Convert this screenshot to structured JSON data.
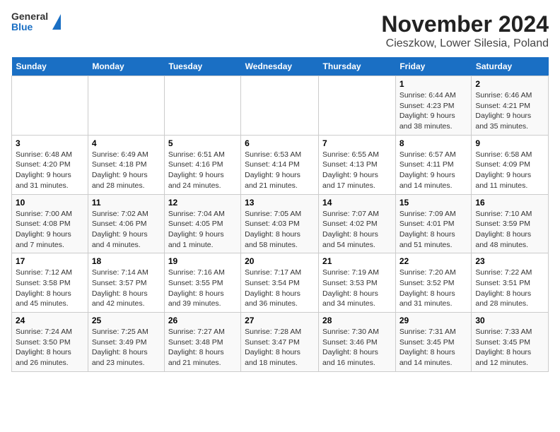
{
  "header": {
    "logo_general": "General",
    "logo_blue": "Blue",
    "title": "November 2024",
    "subtitle": "Cieszkow, Lower Silesia, Poland"
  },
  "weekdays": [
    "Sunday",
    "Monday",
    "Tuesday",
    "Wednesday",
    "Thursday",
    "Friday",
    "Saturday"
  ],
  "weeks": [
    [
      {
        "day": "",
        "info": ""
      },
      {
        "day": "",
        "info": ""
      },
      {
        "day": "",
        "info": ""
      },
      {
        "day": "",
        "info": ""
      },
      {
        "day": "",
        "info": ""
      },
      {
        "day": "1",
        "info": "Sunrise: 6:44 AM\nSunset: 4:23 PM\nDaylight: 9 hours and 38 minutes."
      },
      {
        "day": "2",
        "info": "Sunrise: 6:46 AM\nSunset: 4:21 PM\nDaylight: 9 hours and 35 minutes."
      }
    ],
    [
      {
        "day": "3",
        "info": "Sunrise: 6:48 AM\nSunset: 4:20 PM\nDaylight: 9 hours and 31 minutes."
      },
      {
        "day": "4",
        "info": "Sunrise: 6:49 AM\nSunset: 4:18 PM\nDaylight: 9 hours and 28 minutes."
      },
      {
        "day": "5",
        "info": "Sunrise: 6:51 AM\nSunset: 4:16 PM\nDaylight: 9 hours and 24 minutes."
      },
      {
        "day": "6",
        "info": "Sunrise: 6:53 AM\nSunset: 4:14 PM\nDaylight: 9 hours and 21 minutes."
      },
      {
        "day": "7",
        "info": "Sunrise: 6:55 AM\nSunset: 4:13 PM\nDaylight: 9 hours and 17 minutes."
      },
      {
        "day": "8",
        "info": "Sunrise: 6:57 AM\nSunset: 4:11 PM\nDaylight: 9 hours and 14 minutes."
      },
      {
        "day": "9",
        "info": "Sunrise: 6:58 AM\nSunset: 4:09 PM\nDaylight: 9 hours and 11 minutes."
      }
    ],
    [
      {
        "day": "10",
        "info": "Sunrise: 7:00 AM\nSunset: 4:08 PM\nDaylight: 9 hours and 7 minutes."
      },
      {
        "day": "11",
        "info": "Sunrise: 7:02 AM\nSunset: 4:06 PM\nDaylight: 9 hours and 4 minutes."
      },
      {
        "day": "12",
        "info": "Sunrise: 7:04 AM\nSunset: 4:05 PM\nDaylight: 9 hours and 1 minute."
      },
      {
        "day": "13",
        "info": "Sunrise: 7:05 AM\nSunset: 4:03 PM\nDaylight: 8 hours and 58 minutes."
      },
      {
        "day": "14",
        "info": "Sunrise: 7:07 AM\nSunset: 4:02 PM\nDaylight: 8 hours and 54 minutes."
      },
      {
        "day": "15",
        "info": "Sunrise: 7:09 AM\nSunset: 4:01 PM\nDaylight: 8 hours and 51 minutes."
      },
      {
        "day": "16",
        "info": "Sunrise: 7:10 AM\nSunset: 3:59 PM\nDaylight: 8 hours and 48 minutes."
      }
    ],
    [
      {
        "day": "17",
        "info": "Sunrise: 7:12 AM\nSunset: 3:58 PM\nDaylight: 8 hours and 45 minutes."
      },
      {
        "day": "18",
        "info": "Sunrise: 7:14 AM\nSunset: 3:57 PM\nDaylight: 8 hours and 42 minutes."
      },
      {
        "day": "19",
        "info": "Sunrise: 7:16 AM\nSunset: 3:55 PM\nDaylight: 8 hours and 39 minutes."
      },
      {
        "day": "20",
        "info": "Sunrise: 7:17 AM\nSunset: 3:54 PM\nDaylight: 8 hours and 36 minutes."
      },
      {
        "day": "21",
        "info": "Sunrise: 7:19 AM\nSunset: 3:53 PM\nDaylight: 8 hours and 34 minutes."
      },
      {
        "day": "22",
        "info": "Sunrise: 7:20 AM\nSunset: 3:52 PM\nDaylight: 8 hours and 31 minutes."
      },
      {
        "day": "23",
        "info": "Sunrise: 7:22 AM\nSunset: 3:51 PM\nDaylight: 8 hours and 28 minutes."
      }
    ],
    [
      {
        "day": "24",
        "info": "Sunrise: 7:24 AM\nSunset: 3:50 PM\nDaylight: 8 hours and 26 minutes."
      },
      {
        "day": "25",
        "info": "Sunrise: 7:25 AM\nSunset: 3:49 PM\nDaylight: 8 hours and 23 minutes."
      },
      {
        "day": "26",
        "info": "Sunrise: 7:27 AM\nSunset: 3:48 PM\nDaylight: 8 hours and 21 minutes."
      },
      {
        "day": "27",
        "info": "Sunrise: 7:28 AM\nSunset: 3:47 PM\nDaylight: 8 hours and 18 minutes."
      },
      {
        "day": "28",
        "info": "Sunrise: 7:30 AM\nSunset: 3:46 PM\nDaylight: 8 hours and 16 minutes."
      },
      {
        "day": "29",
        "info": "Sunrise: 7:31 AM\nSunset: 3:45 PM\nDaylight: 8 hours and 14 minutes."
      },
      {
        "day": "30",
        "info": "Sunrise: 7:33 AM\nSunset: 3:45 PM\nDaylight: 8 hours and 12 minutes."
      }
    ]
  ]
}
